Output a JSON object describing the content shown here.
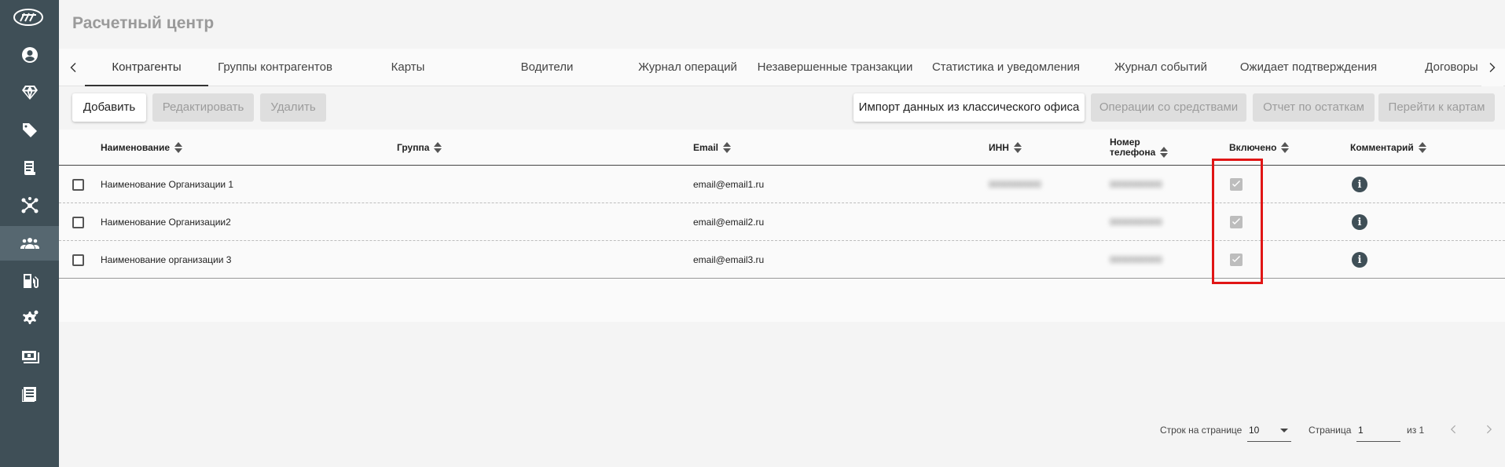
{
  "app": {
    "title": "Расчетный центр"
  },
  "sidebar": {
    "items": [
      {
        "icon": "user-circle-icon"
      },
      {
        "icon": "diamond-icon"
      },
      {
        "icon": "tag-icon"
      },
      {
        "icon": "receipt-icon"
      },
      {
        "icon": "network-icon"
      },
      {
        "icon": "users-group-icon",
        "active": true
      },
      {
        "icon": "fuel-station-icon"
      },
      {
        "icon": "settings-cog-icon"
      },
      {
        "icon": "money-card-icon"
      },
      {
        "icon": "news-list-icon"
      }
    ]
  },
  "tabs": [
    {
      "label": "Контрагенты",
      "active": true
    },
    {
      "label": "Группы контрагентов"
    },
    {
      "label": "Карты"
    },
    {
      "label": "Водители"
    },
    {
      "label": "Журнал операций"
    },
    {
      "label": "Незавершенные транзакции"
    },
    {
      "label": "Статистика и уведомления"
    },
    {
      "label": "Журнал событий"
    },
    {
      "label": "Ожидает подтверждения"
    },
    {
      "label": "Договоры"
    }
  ],
  "toolbar": {
    "add": "Добавить",
    "edit": "Редактировать",
    "delete": "Удалить",
    "import": "Импорт данных из классического офиса",
    "operations": "Операции со средствами",
    "balance_report": "Отчет по остаткам",
    "go_to_cards": "Перейти к картам"
  },
  "table": {
    "columns": {
      "name": "Наименование",
      "group": "Группа",
      "email": "Email",
      "inn": "ИНН",
      "phone_line1": "Номер",
      "phone_line2": "телефона",
      "enabled": "Включено",
      "comment": "Комментарий"
    },
    "rows": [
      {
        "name": "Наименование Организации 1",
        "group": "",
        "email": "email@email1.ru",
        "inn": "0000000000",
        "phone": "0000000000",
        "enabled": true
      },
      {
        "name": "Наименование Организации2",
        "group": "",
        "email": "email@email2.ru",
        "inn": "",
        "phone": "0000000000",
        "enabled": true
      },
      {
        "name": "Наименование организации 3",
        "group": "",
        "email": "email@email3.ru",
        "inn": "",
        "phone": "0000000000",
        "enabled": true
      }
    ]
  },
  "pagination": {
    "rows_per_page_label": "Строк на странице",
    "rows_per_page": "10",
    "page_label": "Страница",
    "page": "1",
    "of_label": "из 1"
  },
  "colors": {
    "sidebar": "#3f4f57",
    "highlight": "#e01515"
  }
}
